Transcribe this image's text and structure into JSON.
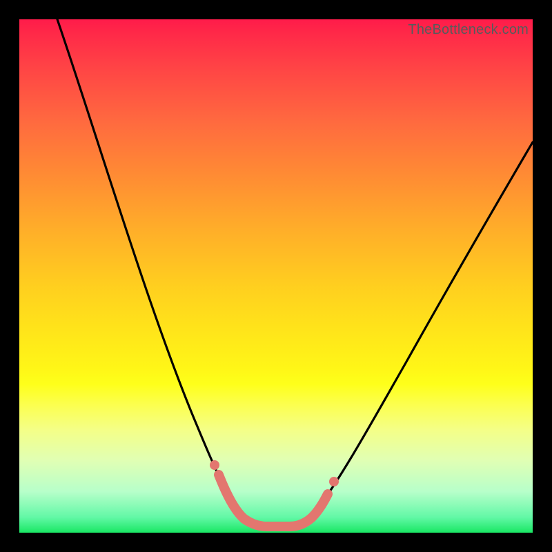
{
  "watermark": "TheBottleneck.com",
  "colors": {
    "frame": "#000000",
    "curve": "#000000",
    "thick_segment": "#e3766f",
    "dot": "#e3766f"
  },
  "chart_data": {
    "type": "line",
    "title": "",
    "xlabel": "",
    "ylabel": "",
    "xlim": [
      0,
      100
    ],
    "ylim": [
      0,
      100
    ],
    "series": [
      {
        "name": "curve",
        "x": [
          0,
          6,
          12,
          18,
          24,
          30,
          36,
          40,
          43,
          46,
          49,
          52,
          55,
          58,
          63,
          70,
          78,
          86,
          94,
          100
        ],
        "y": [
          100,
          87,
          74,
          61,
          48,
          35,
          22,
          13,
          7,
          3,
          1.5,
          1.5,
          3,
          7,
          15,
          27,
          40,
          54,
          67,
          77
        ]
      }
    ],
    "highlight_segment": {
      "x": [
        40,
        43,
        46,
        49,
        52,
        55,
        58
      ],
      "y": [
        13,
        7,
        3,
        1.5,
        1.5,
        3,
        7
      ]
    },
    "highlight_dots": [
      {
        "x": 40,
        "y": 13
      },
      {
        "x": 58,
        "y": 7
      }
    ],
    "legend": null,
    "grid": false
  }
}
